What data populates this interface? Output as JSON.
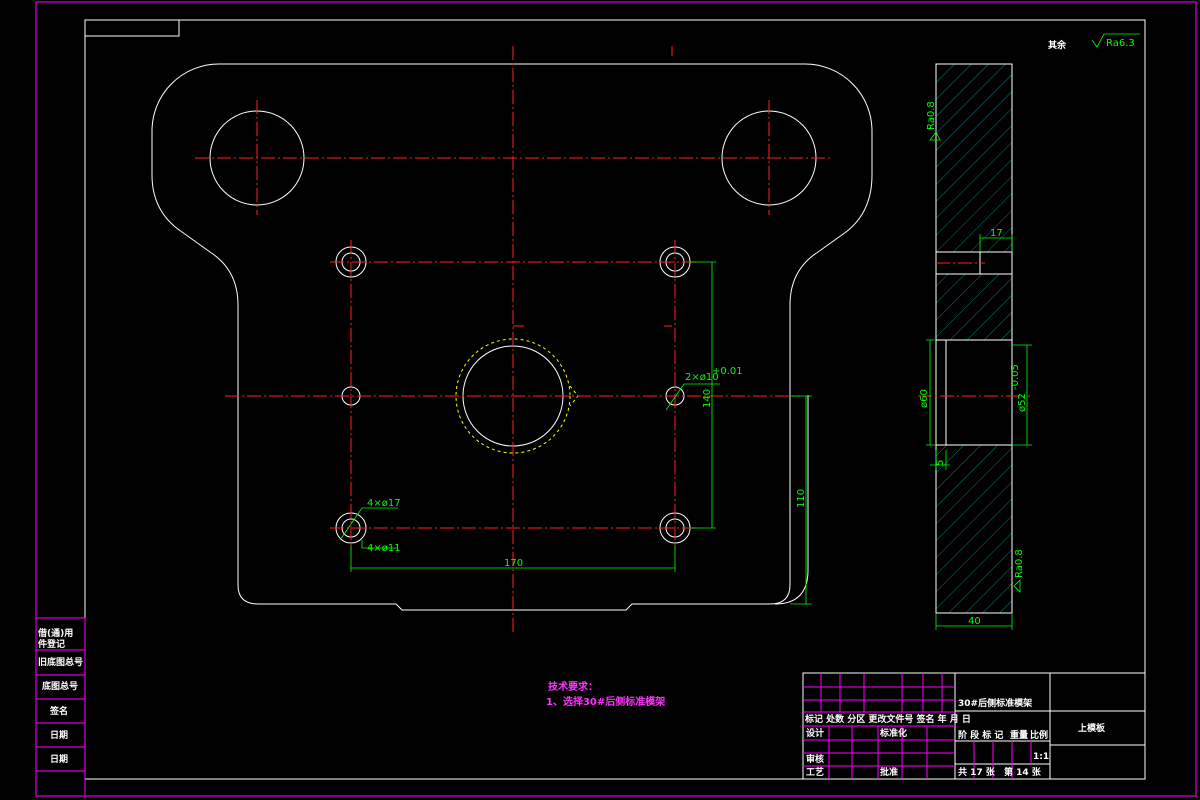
{
  "drawing": {
    "roughness_general": {
      "label": "其余",
      "value": "Ra6.3"
    },
    "dimensions": {
      "hole_fit": "2×ø10",
      "hole_fit_tol": "+0.01",
      "height_140": "140",
      "height_110": "110",
      "width_170": "170",
      "counterbore": "4×ø17",
      "through_hole": "4×ø11",
      "side_17": "17",
      "side_60": "ø60",
      "side_52": "ø52",
      "side_52_tol": "-0.05",
      "side_5": "5",
      "side_40": "40",
      "ra_top": "Ra0.8",
      "ra_bottom": "Ra0.8"
    }
  },
  "tech_requirements": {
    "title": "技术要求：",
    "line1": "1、选择30#后侧标准模架"
  },
  "side_labels": [
    "借(通)用",
    "件登记",
    "旧底图总号",
    "底图总号",
    "签名",
    "日期",
    "日期"
  ],
  "title_block": {
    "mold_name": "30#后侧标准模架",
    "part_name": "上模板",
    "rev_headers": "标记 处数 分区 更改文件号 签名 年 月 日",
    "design": "设计",
    "standardize": "标准化",
    "review": "审核",
    "process": "工艺",
    "approve": "批准",
    "stage": "阶 段 标 记",
    "weight": "重量",
    "scale_label": "比例",
    "scale": "1:1",
    "sheets": "共 17 张",
    "sheet_no": "第 14 张"
  }
}
